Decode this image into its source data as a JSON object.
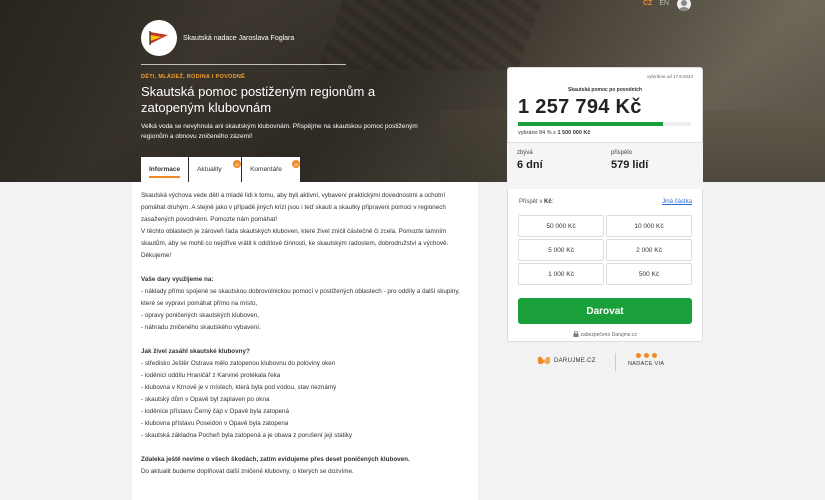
{
  "hero": {
    "org_name": "Skautská nadace Jaroslava Foglara",
    "tags": "DĚTI, MLÁDEŽ, RODINA I POVODNĚ",
    "title": "Skautská pomoc postiženým regionům a zatopeným klubovnám",
    "subtitle": "Velká voda se nevyhnula ani skautským klubovnám. Přispějme na skautskou pomoc postiženým regionům a obnovu zničeného zázemí!"
  },
  "lang": {
    "cz": "CZ",
    "en": "EN"
  },
  "tabs": [
    {
      "label": "Informace"
    },
    {
      "label": "Aktuality",
      "badge": "10"
    },
    {
      "label": "Komentáře",
      "badge": "10"
    }
  ],
  "content": {
    "p1": "Skautská výchova vede děti a mladé lidi k tomu, aby byli aktivní, vybavení praktickými dovednostmi a ochotní pomáhat druhým. A stejně jako v případě jiných krizí jsou i teď skauti a skautky připraveni pomoci v regionech zasažených povodněmi. Pomozte nám pomáhat!",
    "p2": "V těchto oblastech je zároveň řada skautských kluboven, které živel zničil částečně či zcela. Pomozte tamním skautům, aby se mohli co nejdříve vrátit k oddílové činnosti, ke skautským radostem, dobrodružství a výchově.",
    "p3": "Děkujeme!",
    "h1": "Vaše dary využijeme na:",
    "l1": "- náklady přímo spojené se skautskou dobrovolnickou pomocí v postižených oblastech - pro oddíly a další skupiny, které se vypraví pomáhat přímo na místo,",
    "l2": "- opravy poničených skautských kluboven,",
    "l3": "- náhradu zničeného skautského vybavení.",
    "h2": "Jak živel zasáhl skautské klubovny?",
    "l4": "- středisko Ještěr Ostrava mělo zatopenou klubovnu do poloviny oken",
    "l5": "- loděnici oddílu Hraničář z Karviné protékala řeka",
    "l6": "- klubovna v Krnově je v místech, která byla pod vodou, stav neznámý",
    "l7": "- skautský dům v Opavě byl zaplaven po okna",
    "l8": "- loděnice přístavu Černý čáp v Opavě byla zatopená",
    "l9": "- klubovna přístavu Poseidon v Opavě byla zatopena",
    "l10": "- skautská základna Pocheň byla zatopená a je obava z porušení její statiky",
    "h3": "Zdaleka ještě nevíme o všech škodách, zatím evidujeme přes deset poničených kluboven.",
    "p4": "Do aktualit budeme doplňovat další zničené klubovny, o kterých se dozvíme."
  },
  "card": {
    "date": "vybíráme od 17.9.2024",
    "campaign": "Skautská pomoc po povodních",
    "amount": "1 257 794 Kč",
    "progress_fraction": 0.84,
    "progress_prefix": "vybráno 84 % z ",
    "goal": "1 500 000 Kč",
    "remaining_label": "zbývá",
    "remaining_value": "6 dní",
    "donors_label": "přispělo",
    "donors_value": "579 lidí",
    "contribute_prefix": "Přispět v ",
    "currency": "Kč",
    "other_amount": "Jiná částka",
    "amounts": [
      "50 000 Kč",
      "10 000 Kč",
      "5 000 Kč",
      "2 000 Kč",
      "1 000 Kč",
      "500 Kč"
    ],
    "donate": "Darovat",
    "secured": "zabezpečeno Darujme.cz"
  },
  "partners": {
    "darujme": "DARUJME.CZ",
    "via": "NADACE VIA"
  },
  "colors": {
    "accent": "#f08a24",
    "green": "#1aa03a",
    "link": "#2b6cd6"
  }
}
